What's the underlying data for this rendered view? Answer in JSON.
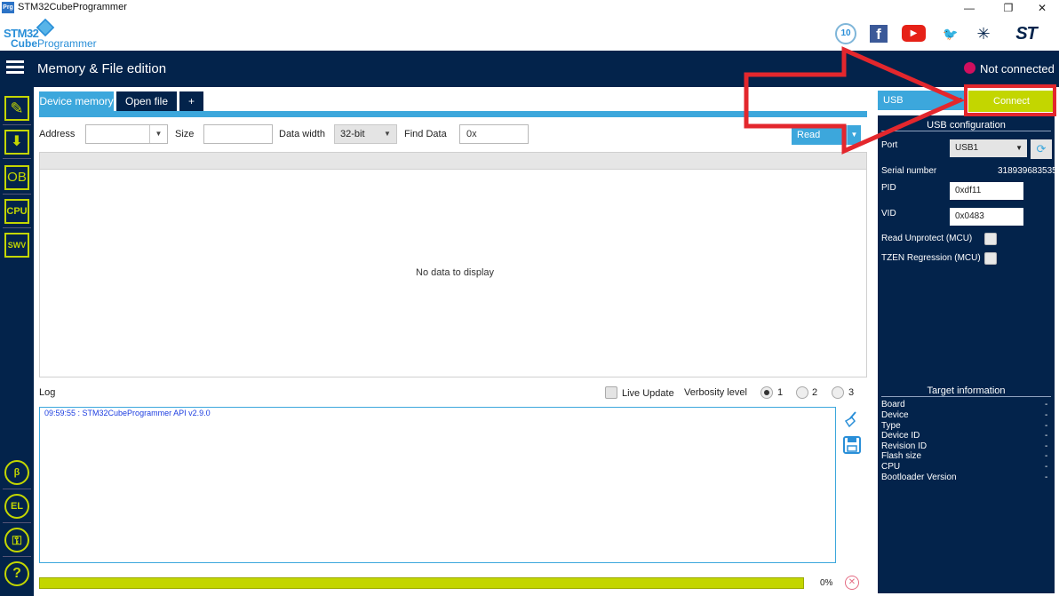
{
  "window": {
    "title": "STM32CubeProgrammer",
    "app_icon_text": "Prg",
    "minimize": "—",
    "maximize": "❐",
    "close": "✕"
  },
  "logo": {
    "line1": "STM32",
    "line2a": "Cube",
    "line2b": "Programmer"
  },
  "social": {
    "anniversary": "10",
    "facebook": "f",
    "youtube": "▶",
    "twitter": "🐦",
    "network": "✳",
    "st": "ST"
  },
  "topbar": {
    "title": "Memory & File edition",
    "status": "Not connected"
  },
  "nav": {
    "edit": "✎",
    "download": "⬇",
    "ob": "OB",
    "cpu": "CPU",
    "swv": "SWV",
    "beta": "β",
    "el": "EL",
    "key": "⚿",
    "help": "?"
  },
  "tabs": [
    {
      "label": "Device memory"
    },
    {
      "label": "Open file"
    },
    {
      "label": "+"
    }
  ],
  "toolbar": {
    "address_label": "Address",
    "address_value": "",
    "size_label": "Size",
    "size_value": "",
    "data_width_label": "Data width",
    "data_width_value": "32-bit",
    "find_label": "Find Data",
    "find_value": "0x",
    "read_label": "Read"
  },
  "memory": {
    "empty_text": "No data to display"
  },
  "log": {
    "title": "Log",
    "live_update": "Live Update",
    "verbosity_label": "Verbosity level",
    "verbosity_options": [
      "1",
      "2",
      "3"
    ],
    "lines": [
      "09:59:55 : STM32CubeProgrammer API v2.9.0"
    ],
    "progress_percent": 100,
    "progress_text": "0%"
  },
  "right": {
    "interface": "USB",
    "connect_label": "Connect",
    "usb_config_title": "USB configuration",
    "port_label": "Port",
    "port_value": "USB1",
    "serial_label": "Serial number",
    "serial_value": "318939683535",
    "pid_label": "PID",
    "pid_value": "0xdf11",
    "vid_label": "VID",
    "vid_value": "0x0483",
    "read_unprotect_label": "Read Unprotect (MCU)",
    "tzen_label": "TZEN Regression (MCU)",
    "target_title": "Target information",
    "target_rows": [
      {
        "label": "Board",
        "value": "-"
      },
      {
        "label": "Device",
        "value": "-"
      },
      {
        "label": "Type",
        "value": "-"
      },
      {
        "label": "Device ID",
        "value": "-"
      },
      {
        "label": "Revision ID",
        "value": "-"
      },
      {
        "label": "Flash size",
        "value": "-"
      },
      {
        "label": "CPU",
        "value": "-"
      },
      {
        "label": "Bootloader Version",
        "value": "-"
      }
    ]
  },
  "colors": {
    "navy": "#03234b",
    "blue": "#3ca7dc",
    "lime": "#c3d600",
    "red": "#e3272d",
    "status": "#d10f5e"
  }
}
